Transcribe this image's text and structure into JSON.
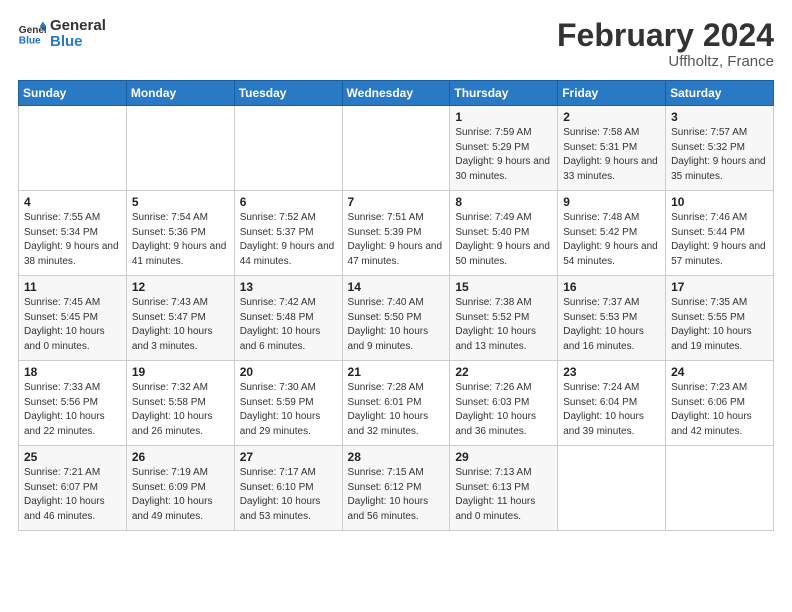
{
  "header": {
    "logo_line1": "General",
    "logo_line2": "Blue",
    "title": "February 2024",
    "subtitle": "Uffholtz, France"
  },
  "columns": [
    "Sunday",
    "Monday",
    "Tuesday",
    "Wednesday",
    "Thursday",
    "Friday",
    "Saturday"
  ],
  "weeks": [
    [
      {
        "day": "",
        "info": ""
      },
      {
        "day": "",
        "info": ""
      },
      {
        "day": "",
        "info": ""
      },
      {
        "day": "",
        "info": ""
      },
      {
        "day": "1",
        "info": "Sunrise: 7:59 AM\nSunset: 5:29 PM\nDaylight: 9 hours and 30 minutes."
      },
      {
        "day": "2",
        "info": "Sunrise: 7:58 AM\nSunset: 5:31 PM\nDaylight: 9 hours and 33 minutes."
      },
      {
        "day": "3",
        "info": "Sunrise: 7:57 AM\nSunset: 5:32 PM\nDaylight: 9 hours and 35 minutes."
      }
    ],
    [
      {
        "day": "4",
        "info": "Sunrise: 7:55 AM\nSunset: 5:34 PM\nDaylight: 9 hours and 38 minutes."
      },
      {
        "day": "5",
        "info": "Sunrise: 7:54 AM\nSunset: 5:36 PM\nDaylight: 9 hours and 41 minutes."
      },
      {
        "day": "6",
        "info": "Sunrise: 7:52 AM\nSunset: 5:37 PM\nDaylight: 9 hours and 44 minutes."
      },
      {
        "day": "7",
        "info": "Sunrise: 7:51 AM\nSunset: 5:39 PM\nDaylight: 9 hours and 47 minutes."
      },
      {
        "day": "8",
        "info": "Sunrise: 7:49 AM\nSunset: 5:40 PM\nDaylight: 9 hours and 50 minutes."
      },
      {
        "day": "9",
        "info": "Sunrise: 7:48 AM\nSunset: 5:42 PM\nDaylight: 9 hours and 54 minutes."
      },
      {
        "day": "10",
        "info": "Sunrise: 7:46 AM\nSunset: 5:44 PM\nDaylight: 9 hours and 57 minutes."
      }
    ],
    [
      {
        "day": "11",
        "info": "Sunrise: 7:45 AM\nSunset: 5:45 PM\nDaylight: 10 hours and 0 minutes."
      },
      {
        "day": "12",
        "info": "Sunrise: 7:43 AM\nSunset: 5:47 PM\nDaylight: 10 hours and 3 minutes."
      },
      {
        "day": "13",
        "info": "Sunrise: 7:42 AM\nSunset: 5:48 PM\nDaylight: 10 hours and 6 minutes."
      },
      {
        "day": "14",
        "info": "Sunrise: 7:40 AM\nSunset: 5:50 PM\nDaylight: 10 hours and 9 minutes."
      },
      {
        "day": "15",
        "info": "Sunrise: 7:38 AM\nSunset: 5:52 PM\nDaylight: 10 hours and 13 minutes."
      },
      {
        "day": "16",
        "info": "Sunrise: 7:37 AM\nSunset: 5:53 PM\nDaylight: 10 hours and 16 minutes."
      },
      {
        "day": "17",
        "info": "Sunrise: 7:35 AM\nSunset: 5:55 PM\nDaylight: 10 hours and 19 minutes."
      }
    ],
    [
      {
        "day": "18",
        "info": "Sunrise: 7:33 AM\nSunset: 5:56 PM\nDaylight: 10 hours and 22 minutes."
      },
      {
        "day": "19",
        "info": "Sunrise: 7:32 AM\nSunset: 5:58 PM\nDaylight: 10 hours and 26 minutes."
      },
      {
        "day": "20",
        "info": "Sunrise: 7:30 AM\nSunset: 5:59 PM\nDaylight: 10 hours and 29 minutes."
      },
      {
        "day": "21",
        "info": "Sunrise: 7:28 AM\nSunset: 6:01 PM\nDaylight: 10 hours and 32 minutes."
      },
      {
        "day": "22",
        "info": "Sunrise: 7:26 AM\nSunset: 6:03 PM\nDaylight: 10 hours and 36 minutes."
      },
      {
        "day": "23",
        "info": "Sunrise: 7:24 AM\nSunset: 6:04 PM\nDaylight: 10 hours and 39 minutes."
      },
      {
        "day": "24",
        "info": "Sunrise: 7:23 AM\nSunset: 6:06 PM\nDaylight: 10 hours and 42 minutes."
      }
    ],
    [
      {
        "day": "25",
        "info": "Sunrise: 7:21 AM\nSunset: 6:07 PM\nDaylight: 10 hours and 46 minutes."
      },
      {
        "day": "26",
        "info": "Sunrise: 7:19 AM\nSunset: 6:09 PM\nDaylight: 10 hours and 49 minutes."
      },
      {
        "day": "27",
        "info": "Sunrise: 7:17 AM\nSunset: 6:10 PM\nDaylight: 10 hours and 53 minutes."
      },
      {
        "day": "28",
        "info": "Sunrise: 7:15 AM\nSunset: 6:12 PM\nDaylight: 10 hours and 56 minutes."
      },
      {
        "day": "29",
        "info": "Sunrise: 7:13 AM\nSunset: 6:13 PM\nDaylight: 11 hours and 0 minutes."
      },
      {
        "day": "",
        "info": ""
      },
      {
        "day": "",
        "info": ""
      }
    ]
  ]
}
